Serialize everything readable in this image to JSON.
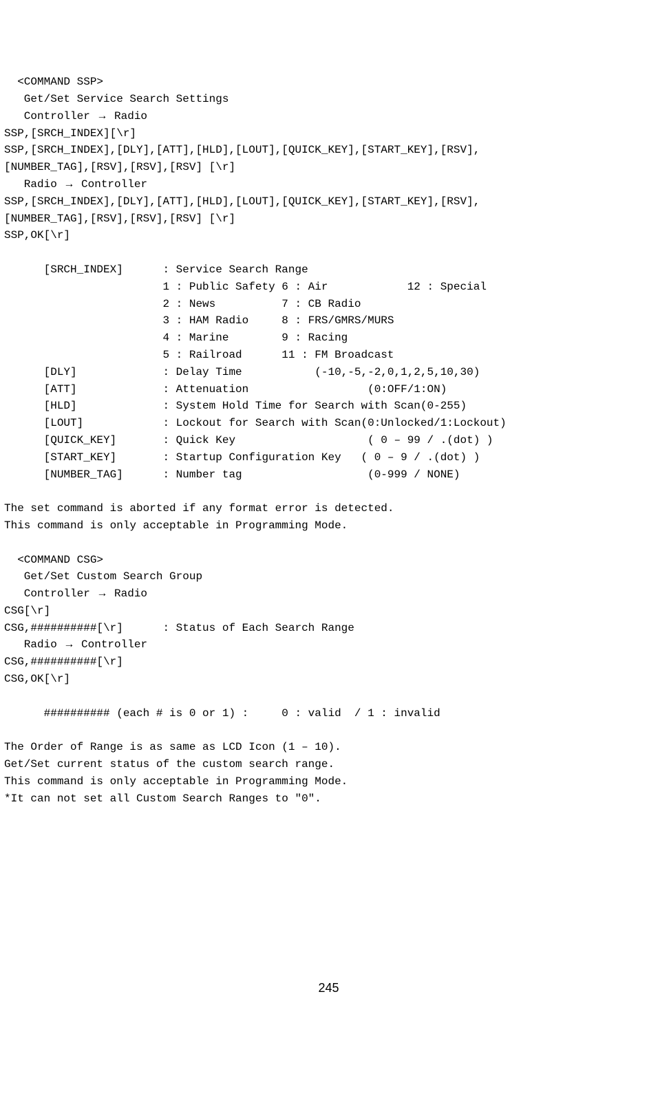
{
  "ssp": {
    "header": "  <COMMAND SSP>",
    "title": "   Get/Set Service Search Settings",
    "dir1_prefix": "   Controller ",
    "dir1_suffix": " Radio",
    "req1": "SSP,[SRCH_INDEX][\\r]",
    "req2": "SSP,[SRCH_INDEX],[DLY],[ATT],[HLD],[LOUT],[QUICK_KEY],[START_KEY],[RSV],",
    "req3": "[NUMBER_TAG],[RSV],[RSV],[RSV] [\\r]",
    "dir2_prefix": "   Radio ",
    "dir2_suffix": " Controller",
    "resp1": "SSP,[SRCH_INDEX],[DLY],[ATT],[HLD],[LOUT],[QUICK_KEY],[START_KEY],[RSV],",
    "resp2": "[NUMBER_TAG],[RSV],[RSV],[RSV] [\\r]",
    "resp3": "SSP,OK[\\r]",
    "params": {
      "srch_index_label": "      [SRCH_INDEX]      : Service Search Range",
      "range1": "                        1 : Public Safety 6 : Air            12 : Special",
      "range2": "                        2 : News          7 : CB Radio",
      "range3": "                        3 : HAM Radio     8 : FRS/GMRS/MURS",
      "range4": "                        4 : Marine        9 : Racing",
      "range5": "                        5 : Railroad      11 : FM Broadcast",
      "dly": "      [DLY]             : Delay Time           (-10,-5,-2,0,1,2,5,10,30)",
      "att": "      [ATT]             : Attenuation                  (0:OFF/1:ON)",
      "hld": "      [HLD]             : System Hold Time for Search with Scan(0-255)",
      "lout": "      [LOUT]            : Lockout for Search with Scan(0:Unlocked/1:Lockout)",
      "quick_key": "      [QUICK_KEY]       : Quick Key                    ( 0 – 99 / .(dot) )",
      "start_key": "      [START_KEY]       : Startup Configuration Key   ( 0 – 9 / .(dot) )",
      "number_tag": "      [NUMBER_TAG]      : Number tag                   (0-999 / NONE)"
    },
    "note1": "The set command is aborted if any format error is detected.",
    "note2": "This command is only acceptable in Programming Mode."
  },
  "csg": {
    "header": "  <COMMAND CSG>",
    "title": "   Get/Set Custom Search Group",
    "dir1_prefix": "   Controller ",
    "dir1_suffix": " Radio",
    "req1": "CSG[\\r]",
    "req2": "CSG,##########[\\r]      : Status of Each Search Range",
    "dir2_prefix": "   Radio ",
    "dir2_suffix": " Controller",
    "resp1": "CSG,##########[\\r]",
    "resp2": "CSG,OK[\\r]",
    "hashnote": "      ########## (each # is 0 or 1) :     0 : valid  / 1 : invalid",
    "note1": "The Order of Range is as same as LCD Icon (1 – 10).",
    "note2": "Get/Set current status of the custom search range.",
    "note3": "This command is only acceptable in Programming Mode.",
    "note4": "*It can not set all Custom Search Ranges to \"0\"."
  },
  "arrow": "→",
  "page_number": "245"
}
